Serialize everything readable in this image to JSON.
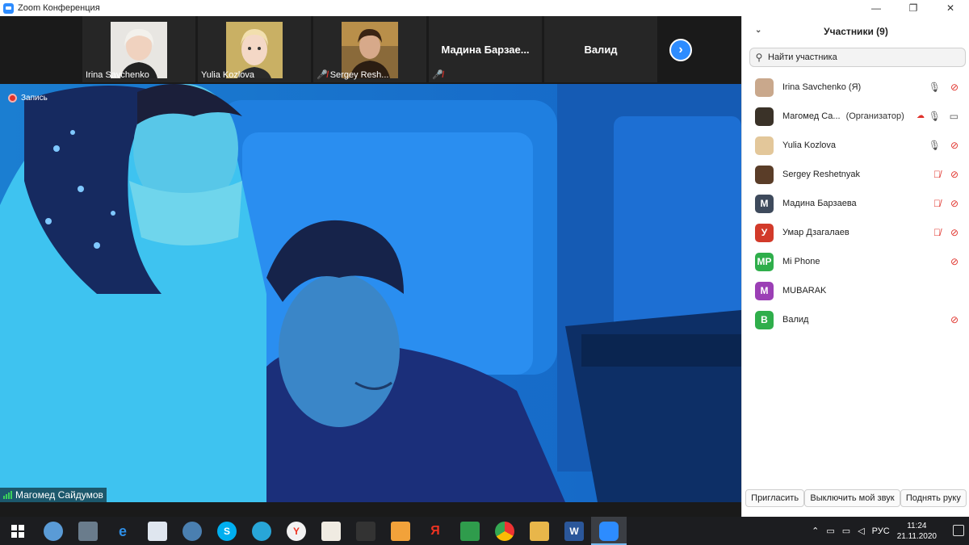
{
  "window": {
    "title": "Zoom Конференция",
    "controls": [
      "—",
      "❐",
      "✕"
    ]
  },
  "gallery": {
    "tiles": [
      {
        "name": "Irina Savchenko",
        "muted": false
      },
      {
        "name": "Yulia Kozlova",
        "muted": false
      },
      {
        "name": "Sergey Resh...",
        "muted": true
      },
      {
        "name": "Мадина  Барзае...",
        "muted": true
      },
      {
        "name": "Валид",
        "muted": false
      }
    ],
    "next_icon": "chevron-right-icon"
  },
  "video": {
    "recording_label": "Запись",
    "speaker_name": "Магомед Сайдумов"
  },
  "participants": {
    "title": "Участники (9)",
    "search_placeholder": "Найти участника",
    "list": [
      {
        "name": "Irina Savchenko (Я)",
        "role": "",
        "avatar": "",
        "avatar_color": "#c9a88c",
        "mic": "on",
        "cam": "off"
      },
      {
        "name": "Магомед Са...",
        "role": "(Организатор)",
        "avatar": "",
        "avatar_color": "#3a3228",
        "mic": "on",
        "cam": "on"
      },
      {
        "name": "Yulia Kozlova",
        "role": "",
        "avatar": "",
        "avatar_color": "#e3c79a",
        "mic": "on",
        "cam": "off"
      },
      {
        "name": "Sergey Reshetnyak",
        "role": "",
        "avatar": "",
        "avatar_color": "#5a3d28",
        "mic": "off",
        "cam": "off"
      },
      {
        "name": "Мадина Барзаева",
        "role": "",
        "avatar": "М",
        "avatar_color": "#3e4a5c",
        "mic": "off",
        "cam": "off"
      },
      {
        "name": "Умар Дзагалаев",
        "role": "",
        "avatar": "У",
        "avatar_color": "#d23a2a",
        "mic": "off",
        "cam": "off"
      },
      {
        "name": "Mi Phone",
        "role": "",
        "avatar": "MP",
        "avatar_color": "#2fae4b",
        "mic": "none",
        "cam": "off"
      },
      {
        "name": "MUBARAK",
        "role": "",
        "avatar": "M",
        "avatar_color": "#9b3fb5",
        "mic": "none",
        "cam": "none"
      },
      {
        "name": "Валид",
        "role": "",
        "avatar": "B",
        "avatar_color": "#2fae4b",
        "mic": "none",
        "cam": "off"
      }
    ],
    "buttons": {
      "invite": "Пригласить",
      "unmute": "Выключить мой звук",
      "raise_hand": "Поднять руку"
    }
  },
  "taskbar": {
    "language": "РУС",
    "time": "11:24",
    "date": "21.11.2020"
  }
}
